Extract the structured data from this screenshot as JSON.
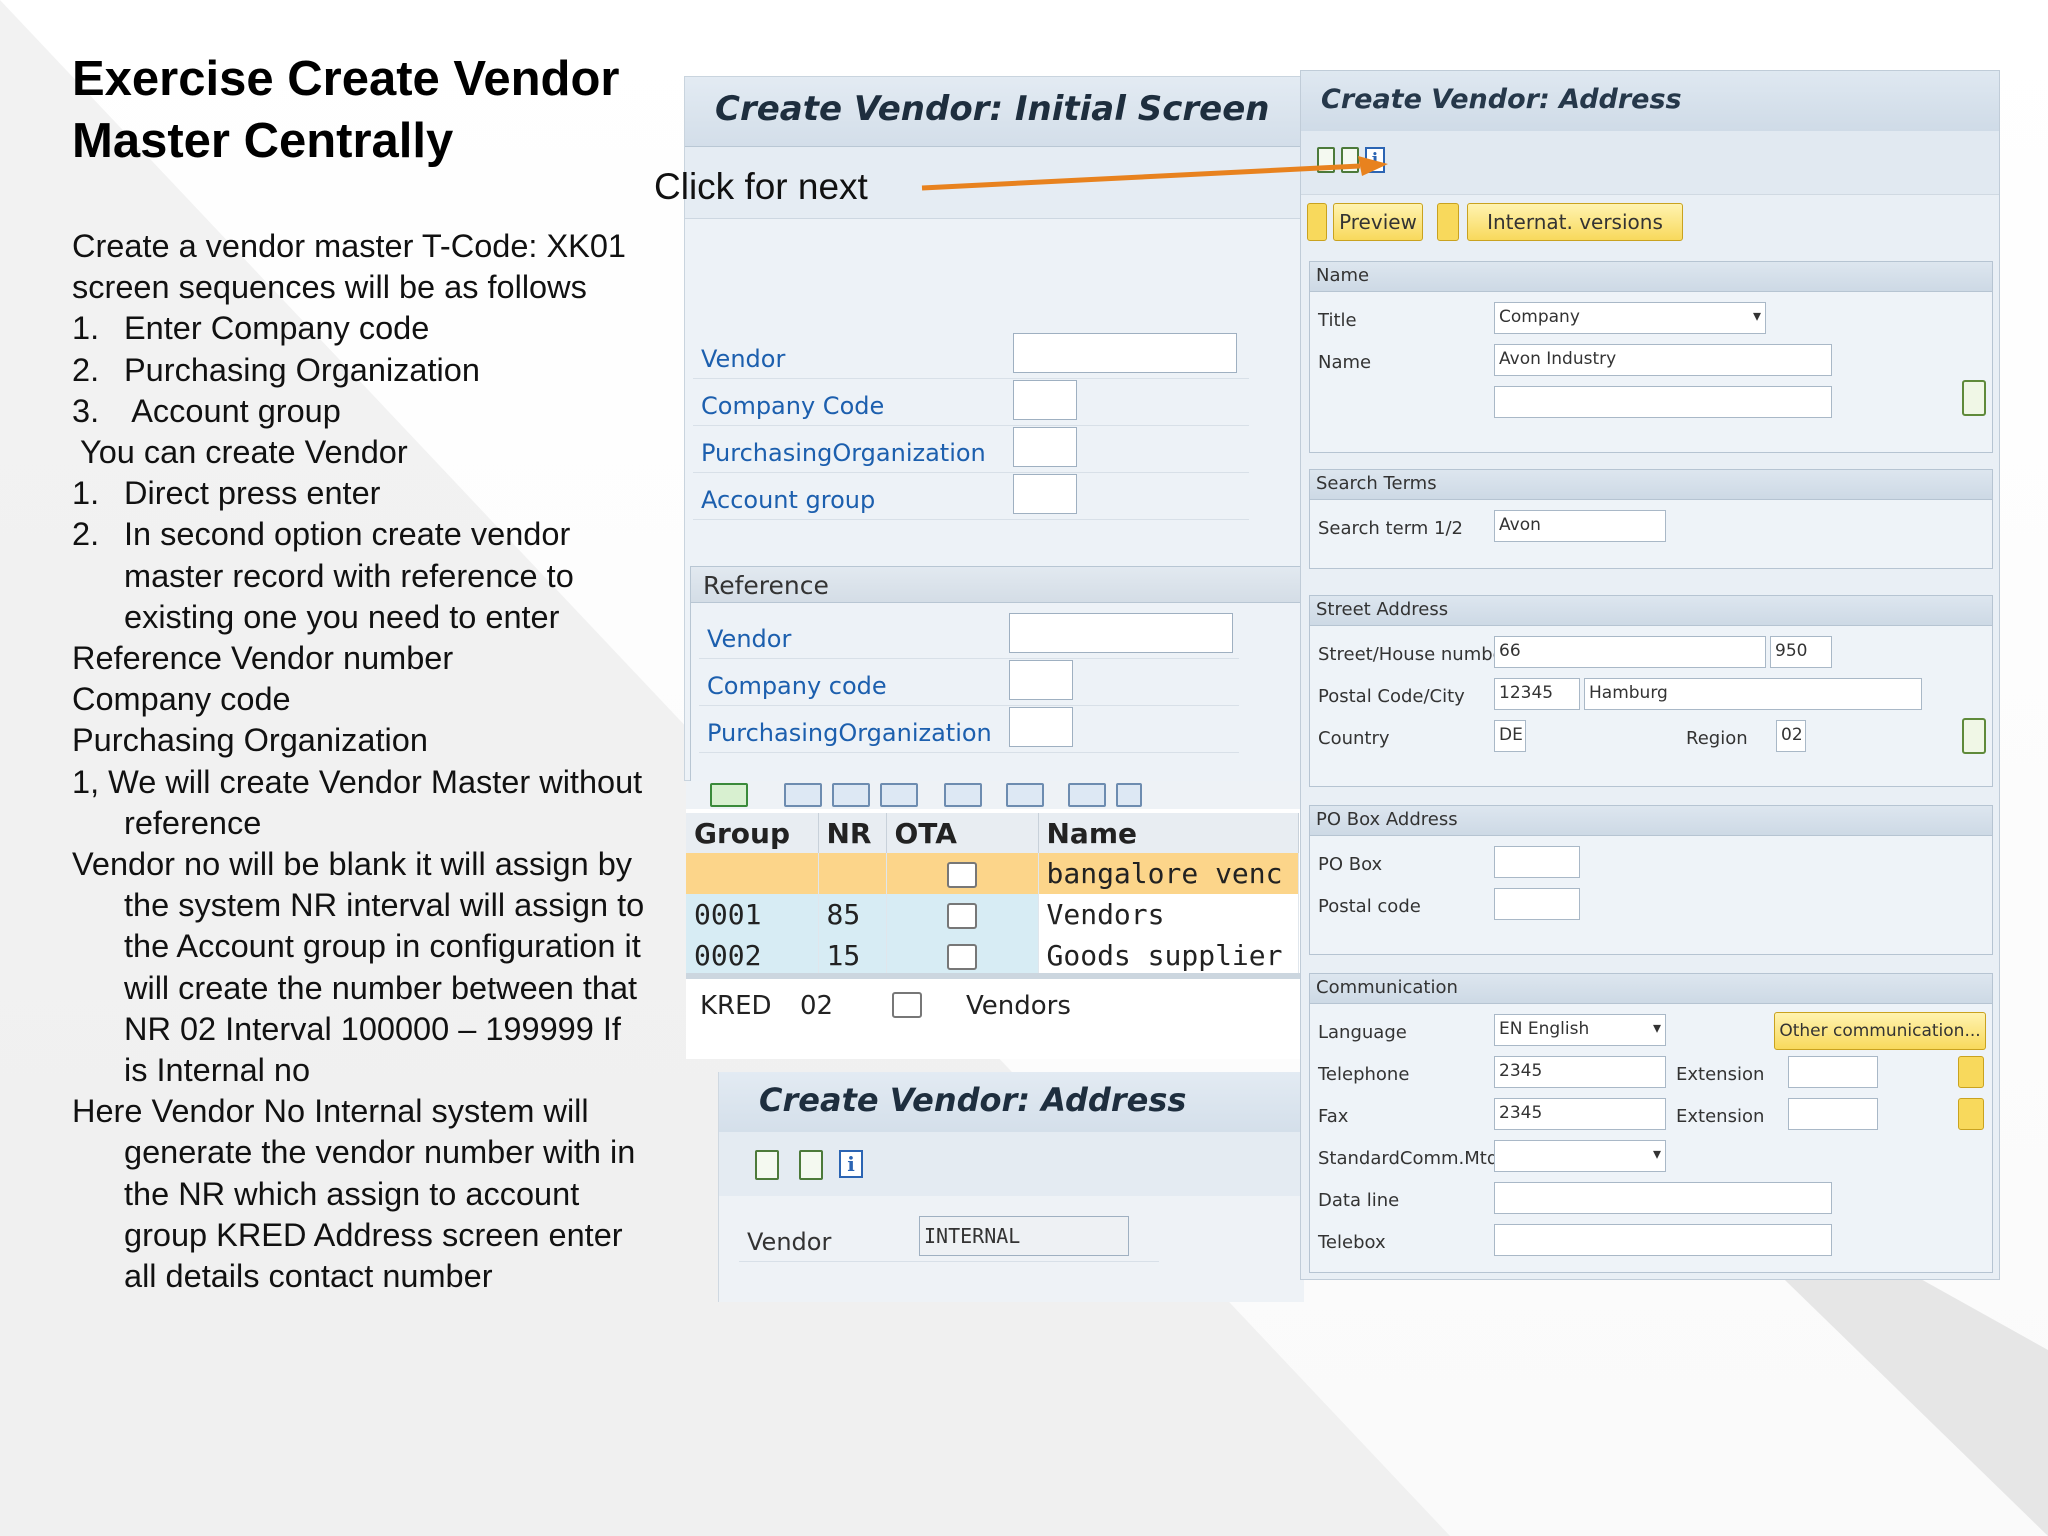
{
  "slide": {
    "title_line1": "Exercise Create Vendor",
    "title_line2": "Master Centrally",
    "click_note": "Click for next",
    "lines": [
      "Create a vendor master T-Code: XK01",
      "screen sequences will be as follows",
      "1.",
      "Enter Company code",
      "2.",
      "Purchasing Organization",
      "3.",
      " Account group",
      " You can create Vendor",
      "1.",
      "Direct press enter",
      "2.",
      "In second option create vendor",
      "master record with reference to",
      "existing one you need to enter",
      "Reference Vendor number",
      "Company code",
      "Purchasing Organization",
      "1, We will create Vendor Master without",
      "reference",
      "Vendor no will be blank it will assign by",
      "the system NR interval will assign to",
      "the Account group in configuration it",
      "will create the number between that",
      "NR  02 Interval 100000 – 199999 If",
      "is Internal no",
      "Here Vendor No Internal system will",
      "generate the vendor number with in",
      "the NR which assign to account",
      "group KRED Address screen enter",
      "all details contact number"
    ]
  },
  "initial_screen": {
    "title": "Create Vendor:  Initial Screen",
    "fields": [
      "Vendor",
      "Company Code",
      "PurchasingOrganization",
      "Account group"
    ],
    "reference": {
      "header": "Reference",
      "fields": [
        "Vendor",
        "Company code",
        "PurchasingOrganization"
      ]
    }
  },
  "account_groups": {
    "columns": [
      "Group",
      "NR",
      "OTA",
      "Name"
    ],
    "rows": [
      {
        "group": "",
        "nr": "",
        "name": "bangalore venc"
      },
      {
        "group": "0001",
        "nr": "85",
        "name": "Vendors"
      },
      {
        "group": "0002",
        "nr": "15",
        "name": "Goods supplier"
      }
    ],
    "lower_row": {
      "group": "KRED",
      "nr": "02",
      "name": "Vendors"
    }
  },
  "address_small": {
    "title": "Create Vendor: Address",
    "vendor_label": "Vendor",
    "vendor_value": "INTERNAL"
  },
  "address": {
    "title": "Create Vendor: Address",
    "preview": "Preview",
    "internat": "Internat. versions",
    "name_section": "Name",
    "title_label": "Title",
    "title_value": "Company",
    "name_label": "Name",
    "name_value": "Avon Industry",
    "search_section": "Search Terms",
    "search_label": "Search term 1/2",
    "search_value": "Avon",
    "street_section": "Street Address",
    "street_label": "Street/House number",
    "street_value": "66",
    "house_value": "950",
    "postal_label": "Postal Code/City",
    "postal_value": "12345",
    "city_value": "Hamburg",
    "country_label": "Country",
    "country_value": "DE",
    "region_label": "Region",
    "region_value": "02",
    "pobox_section": "PO Box Address",
    "pobox_label": "PO Box",
    "postal_code_label": "Postal code",
    "comm_section": "Communication",
    "language_label": "Language",
    "language_value": "EN English",
    "other_comm": "Other communication...",
    "telephone_label": "Telephone",
    "telephone_value": "2345",
    "extension_label": "Extension",
    "fax_label": "Fax",
    "fax_value": "2345",
    "std_label": "StandardComm.Mtd",
    "dataline_label": "Data line",
    "telebox_label": "Telebox"
  },
  "colors": {
    "arrow": "#e8821e",
    "sap_label": "#1c5fae",
    "selected_row": "#fcd58a",
    "button_yellow": "#f8d95c"
  }
}
